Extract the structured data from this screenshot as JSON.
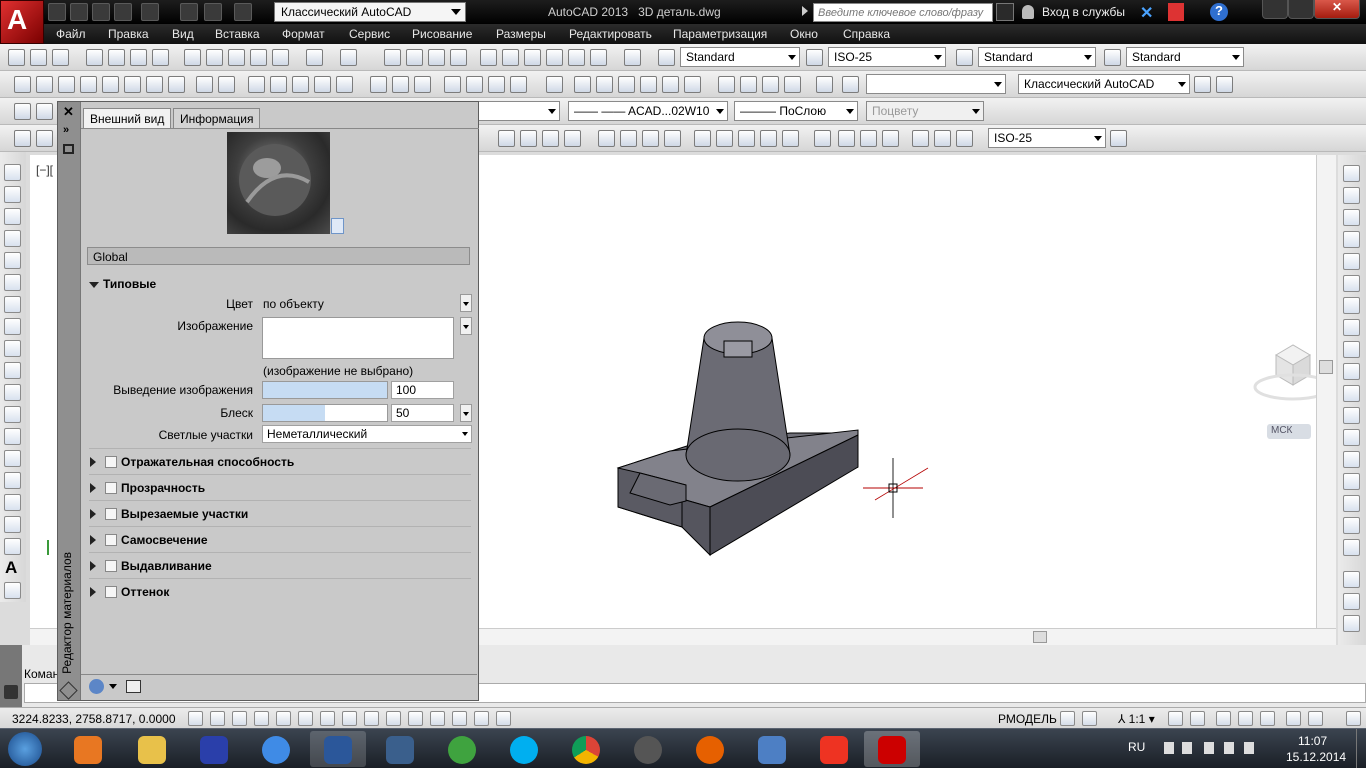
{
  "titlebar": {
    "workspace": "Классический AutoCAD",
    "app_title": "AutoCAD 2013",
    "file_name": "3D деталь.dwg",
    "search_placeholder": "Введите ключевое слово/фразу",
    "login": "Вход в службы"
  },
  "menu": [
    "Файл",
    "Правка",
    "Вид",
    "Вставка",
    "Формат",
    "Сервис",
    "Рисование",
    "Размеры",
    "Редактировать",
    "Параметризация",
    "Окно",
    "Справка"
  ],
  "toolbar1": {
    "text_style": "Standard",
    "dim_style": "ISO-25",
    "table_style": "Standard",
    "mleader_style": "Standard"
  },
  "toolbar2": {
    "workspace": "Классический AutoCAD"
  },
  "toolbar3": {
    "linetype": "——  ——  ACAD...02W10",
    "lineweight": "——— ПоСлою",
    "plotstyle": "Поцвету"
  },
  "toolbar4": {
    "dim_style": "ISO-25"
  },
  "viewport": {
    "label": "[−][",
    "ucs_label": "МСК"
  },
  "material_editor": {
    "vertical_title": "Редактор материалов",
    "tabs": [
      "Внешний вид",
      "Информация"
    ],
    "material_name": "Global",
    "section_generic": "Типовые",
    "color_label": "Цвет",
    "color_value": "по объекту",
    "image_label": "Изображение",
    "image_note": "(изображение не выбрано)",
    "image_fade_label": "Выведение изображения",
    "image_fade_value": "100",
    "image_fade_fraction": 1.0,
    "glossiness_label": "Блеск",
    "glossiness_value": "50",
    "glossiness_fraction": 0.5,
    "highlights_label": "Светлые участки",
    "highlights_value": "Неметаллический",
    "sections": [
      "Отражательная способность",
      "Прозрачность",
      "Вырезаемые участки",
      "Самосвечение",
      "Выдавливание",
      "Оттенок"
    ]
  },
  "command": {
    "prompt": "Коман"
  },
  "status": {
    "coords": "3224.8233, 2758.8717, 0.0000",
    "model": "РМОДЕЛЬ",
    "scale": "1:1"
  },
  "tray": {
    "lang": "RU",
    "time": "11:07",
    "date": "15.12.2014"
  },
  "colors": {
    "title_bg": "#000000",
    "canvas": "#ffffff",
    "panel": "#c9c9c9",
    "accent_red": "#b40000"
  }
}
